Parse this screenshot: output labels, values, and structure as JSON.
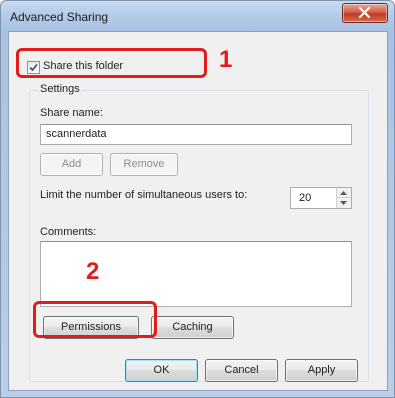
{
  "window": {
    "title": "Advanced Sharing"
  },
  "share_checkbox": {
    "label": "Share this folder",
    "checked": true
  },
  "settings": {
    "legend": "Settings",
    "share_name_label": "Share name:",
    "share_name_value": "scannerdata",
    "add_label": "Add",
    "remove_label": "Remove",
    "limit_label": "Limit the number of simultaneous users to:",
    "limit_value": "20",
    "comments_label": "Comments:",
    "comments_value": "",
    "permissions_label": "Permissions",
    "caching_label": "Caching"
  },
  "footer": {
    "ok_label": "OK",
    "cancel_label": "Cancel",
    "apply_label": "Apply"
  },
  "annotations": {
    "callout_1": "1",
    "callout_2": "2",
    "highlight_color": "#e01d1d"
  },
  "icons": {
    "close": "close-icon",
    "check": "check-icon",
    "spin_up": "chevron-up-icon",
    "spin_down": "chevron-down-icon"
  }
}
